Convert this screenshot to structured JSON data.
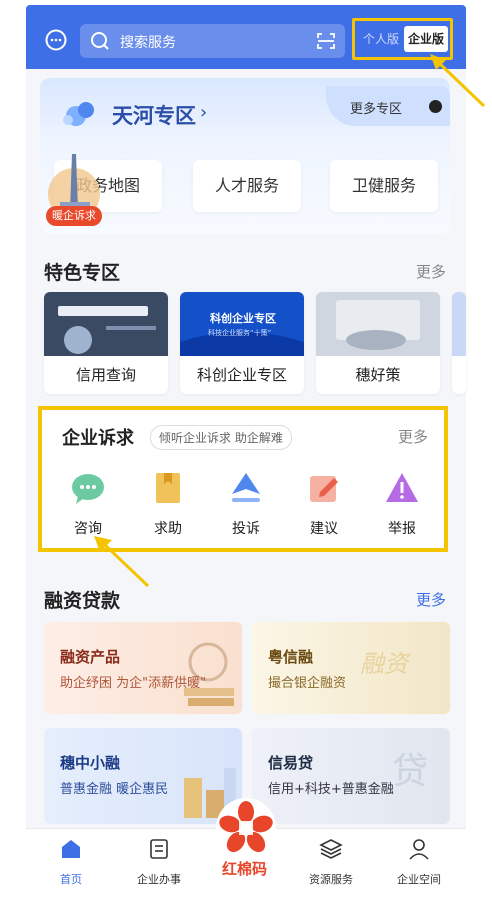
{
  "header": {
    "search_placeholder": "搜索服务",
    "mode_personal": "个人版",
    "mode_enterprise": "企业版"
  },
  "tianhe": {
    "title": "天河专区",
    "more_label": "更多专区",
    "services": [
      "政务地图",
      "人才服务",
      "卫健服务"
    ],
    "badge": "暖企诉求"
  },
  "features": {
    "title": "特色专区",
    "more": "更多",
    "tiles": [
      {
        "label": "信用查询"
      },
      {
        "label": "科创企业专区",
        "banner_text": "科创企业专区",
        "banner_sub": "科技企业服务“十策”"
      },
      {
        "label": "穗好策"
      }
    ]
  },
  "complaint": {
    "title": "企业诉求",
    "subtitle": "倾听企业诉求 助企解难",
    "more": "更多",
    "items": [
      {
        "label": "咨询",
        "icon": "chat-bubble-icon"
      },
      {
        "label": "求助",
        "icon": "bookmark-icon"
      },
      {
        "label": "投诉",
        "icon": "send-icon"
      },
      {
        "label": "建议",
        "icon": "edit-icon"
      },
      {
        "label": "举报",
        "icon": "warning-icon"
      }
    ]
  },
  "finance": {
    "title": "融资贷款",
    "more": "更多",
    "cards": [
      {
        "title": "融资产品",
        "sub": "助企纾困 为企\"添薪供暖\"",
        "watermark": ""
      },
      {
        "title": "粤信融",
        "sub": "撮合银企融资",
        "watermark": "融资"
      },
      {
        "title": "穗中小融",
        "sub": "普惠金融 暖企惠民",
        "watermark": ""
      },
      {
        "title": "信易贷",
        "sub": "信用+科技+普惠金融",
        "watermark": "贷"
      }
    ]
  },
  "tabbar": {
    "items": [
      "首页",
      "企业办事",
      "资源服务",
      "企业空间"
    ],
    "center": "红棉码"
  },
  "colors": {
    "primary": "#3f6fe6",
    "highlight": "#f5c400",
    "brand_red": "#e8462b"
  }
}
